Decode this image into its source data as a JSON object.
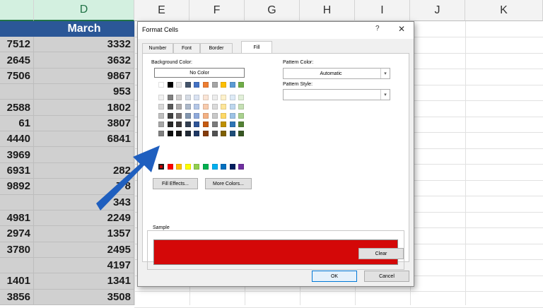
{
  "spreadsheet": {
    "columns": [
      "D",
      "E",
      "F",
      "G",
      "H",
      "I",
      "J",
      "K"
    ],
    "selected_column": "D",
    "header_cell": "March",
    "rows": [
      {
        "c": "7512",
        "d": "3332"
      },
      {
        "c": "2645",
        "d": "3632"
      },
      {
        "c": "7506",
        "d": "9867"
      },
      {
        "c": "",
        "d": "953"
      },
      {
        "c": "2588",
        "d": "1802"
      },
      {
        "c": "61",
        "d": "3807"
      },
      {
        "c": "4440",
        "d": "6841"
      },
      {
        "c": "3969",
        "d": ""
      },
      {
        "c": "6931",
        "d": "282"
      },
      {
        "c": "9892",
        "d": "7 8"
      },
      {
        "c": "",
        "d": "343"
      },
      {
        "c": "4981",
        "d": "2249"
      },
      {
        "c": "2974",
        "d": "1357"
      },
      {
        "c": "3780",
        "d": "2495"
      },
      {
        "c": "",
        "d": "4197"
      },
      {
        "c": "1401",
        "d": "1341"
      },
      {
        "c": "3856",
        "d": "3508"
      }
    ]
  },
  "dialog": {
    "title": "Format Cells",
    "help": "?",
    "close": "✕",
    "tabs": [
      "Number",
      "Font",
      "Border",
      "Fill"
    ],
    "active_tab": "Fill",
    "background_color_label": "Background Color:",
    "no_color_button": "No Color",
    "fill_effects_button": "Fill Effects...",
    "more_colors_button": "More Colors...",
    "pattern_color_label": "Pattern Color:",
    "pattern_color_value": "Automatic",
    "pattern_style_label": "Pattern Style:",
    "pattern_style_value": "",
    "sample_label": "Sample",
    "sample_color": "#d40808",
    "clear_button": "Clear",
    "ok_button": "OK",
    "cancel_button": "Cancel"
  },
  "palette": {
    "theme_top": [
      "#ffffff",
      "#000000",
      "#e7e6e6",
      "#44546a",
      "#4472c4",
      "#ed7d31",
      "#a5a5a5",
      "#ffc000",
      "#5b9bd5",
      "#70ad47"
    ],
    "theme_shades": [
      [
        "#f2f2f2",
        "#808080",
        "#d0cece",
        "#d6dce5",
        "#dae3f3",
        "#fbe5d6",
        "#ededed",
        "#fff2cc",
        "#deebf7",
        "#e2f0d9"
      ],
      [
        "#d9d9d9",
        "#595959",
        "#aeabab",
        "#adb9ca",
        "#b4c7e7",
        "#f8cbad",
        "#dbdbdb",
        "#ffe699",
        "#bdd7ee",
        "#c5e0b4"
      ],
      [
        "#bfbfbf",
        "#404040",
        "#767171",
        "#8497b0",
        "#8faadc",
        "#f4b183",
        "#c9c9c9",
        "#ffd966",
        "#9dc3e6",
        "#a9d18e"
      ],
      [
        "#a6a6a6",
        "#262626",
        "#3b3838",
        "#333f50",
        "#2f5597",
        "#c55a11",
        "#7b7b7b",
        "#bf9000",
        "#2e75b6",
        "#548235"
      ],
      [
        "#808080",
        "#0d0d0d",
        "#171616",
        "#222a35",
        "#1f3864",
        "#843c0c",
        "#525252",
        "#7f6000",
        "#1f4e79",
        "#385723"
      ]
    ],
    "standard": [
      "#c00000",
      "#ff0000",
      "#ffc000",
      "#ffff00",
      "#92d050",
      "#00b050",
      "#00b0f0",
      "#0070c0",
      "#002060",
      "#7030a0"
    ],
    "selected_standard_index": 0
  },
  "annotation": {
    "arrow_color": "#1f5fbf"
  }
}
